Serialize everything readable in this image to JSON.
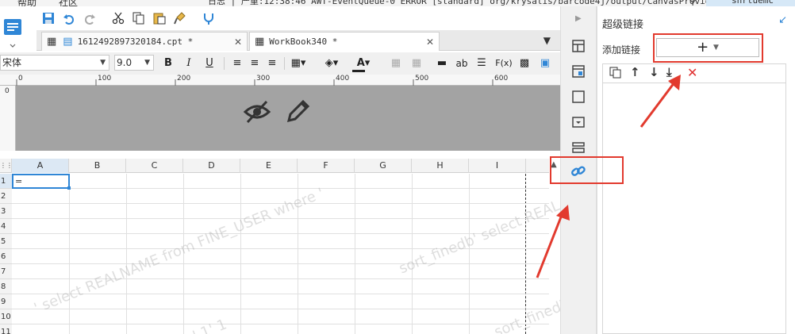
{
  "menu": {
    "help": "帮助",
    "community": "社区"
  },
  "log_line": "日志 | 严重:12:38:46 AWT-EventQueue-0 ERROR [standard] org/krysalis/barcode4j/output/CanvasProvider",
  "user": "snrtuemc",
  "tabs": [
    {
      "label": "1612492897320184.cpt *"
    },
    {
      "label": "WorkBook340 *"
    }
  ],
  "format": {
    "font_name": "宋体",
    "font_size": "9.0",
    "bold": "B",
    "italic": "I",
    "underline": "U",
    "text_tool": "ab",
    "formula_tool": "F(x)"
  },
  "ruler_ticks": [
    "0",
    "100",
    "200",
    "300",
    "400",
    "500",
    "600"
  ],
  "vruler_tick": "0",
  "columns": [
    "A",
    "B",
    "C",
    "D",
    "E",
    "F",
    "G",
    "H",
    "I"
  ],
  "rows": [
    "1",
    "2",
    "3",
    "4",
    "5",
    "6",
    "7",
    "8",
    "9",
    "10",
    "11"
  ],
  "cell_a1": "=",
  "panel": {
    "title": "超级链接",
    "add_label": "添加链接",
    "add_button": "+"
  },
  "watermarks": [
    "' select REALNAME from FINE_USER where '",
    "sort_finedb' select REAL",
    "' 1' 1",
    "sort_finedb"
  ],
  "colors": {
    "accent": "#2f86d6",
    "annotation_red": "#e23a2e",
    "delete_red": "#e03030"
  }
}
